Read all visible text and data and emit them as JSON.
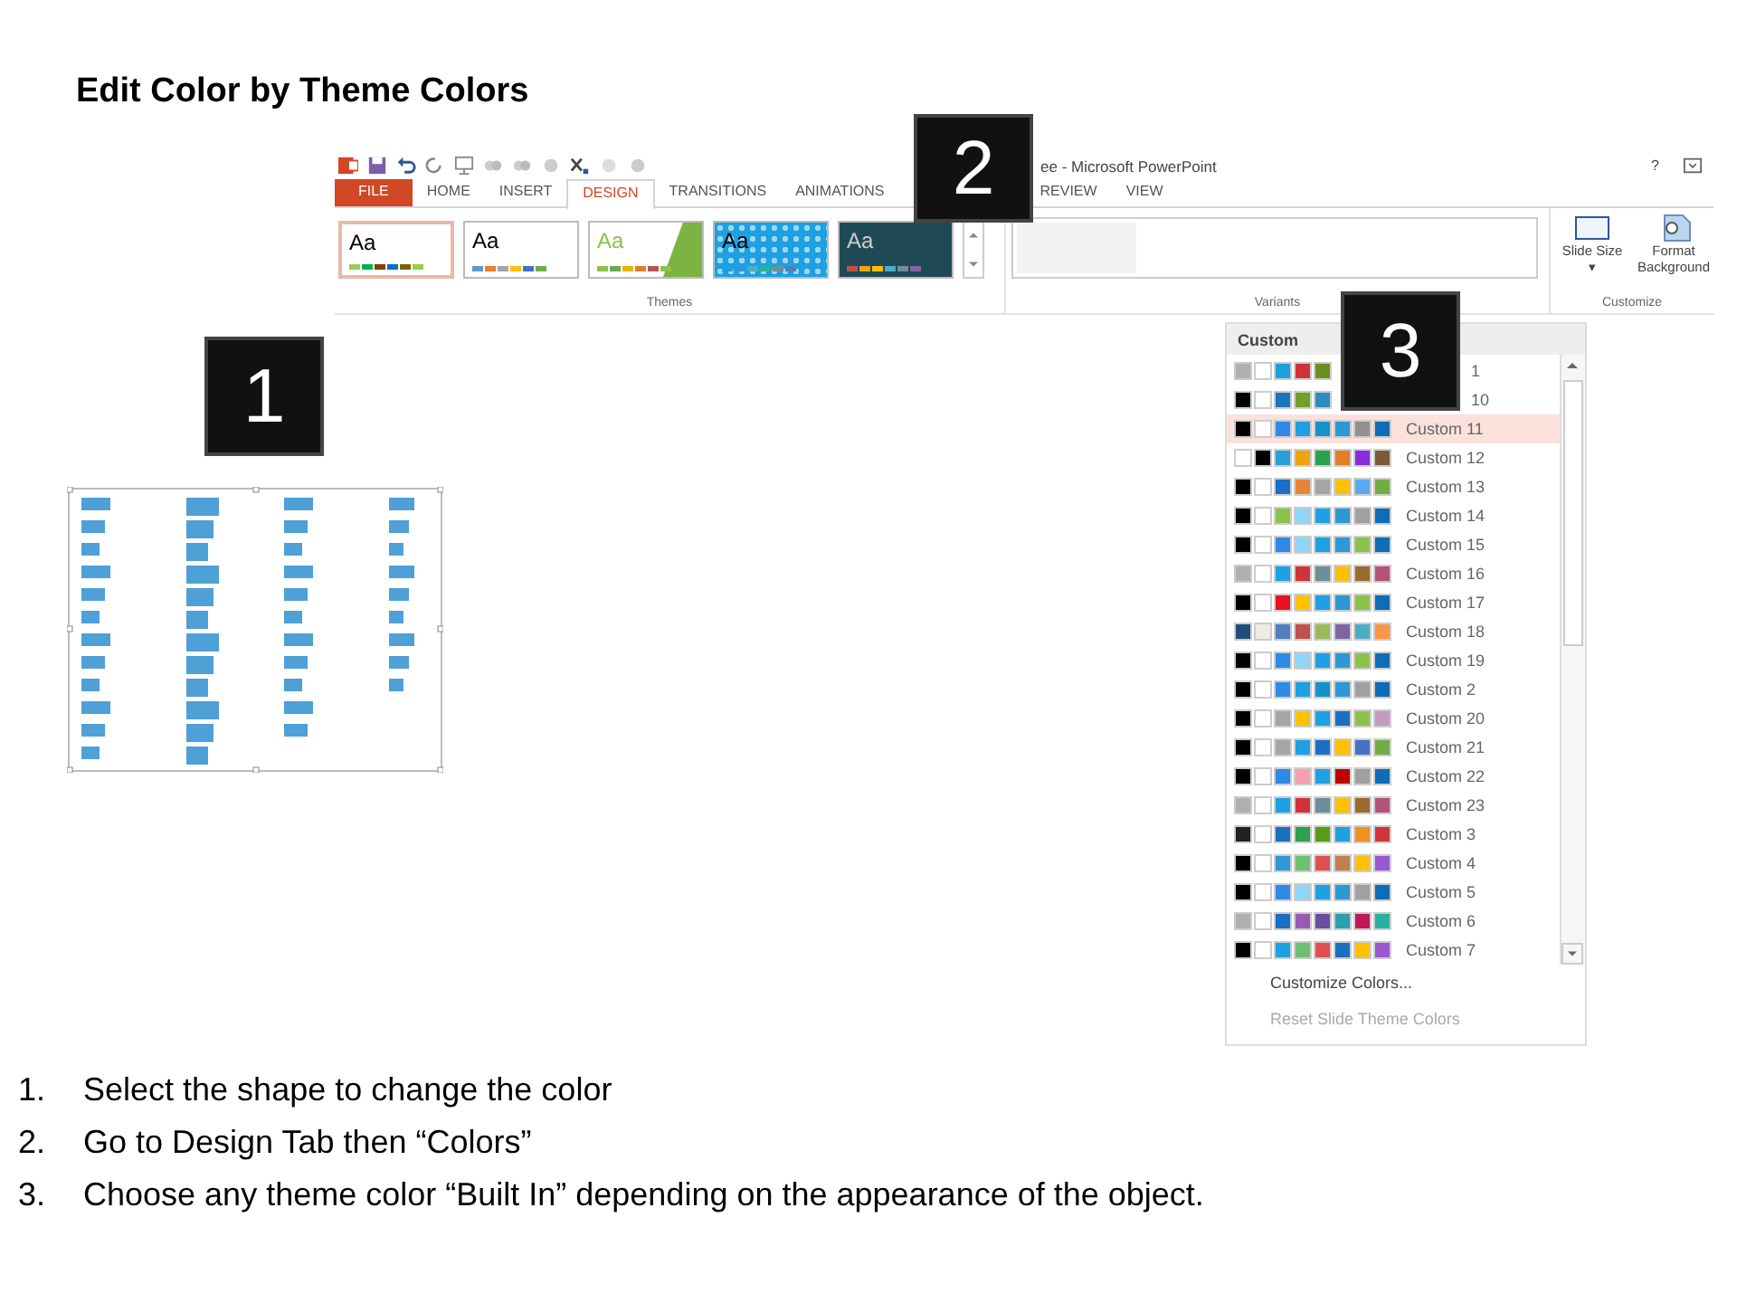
{
  "title": "Edit Color by Theme Colors",
  "ribbon": {
    "window_title": "ee - Microsoft PowerPoint",
    "help": "?",
    "tabs": [
      {
        "label": "FILE",
        "kind": "file",
        "selected": false
      },
      {
        "label": "HOME",
        "kind": "tab",
        "selected": false
      },
      {
        "label": "INSERT",
        "kind": "tab",
        "selected": false
      },
      {
        "label": "DESIGN",
        "kind": "tab",
        "selected": true
      },
      {
        "label": "TRANSITIONS",
        "kind": "tab",
        "selected": false
      },
      {
        "label": "ANIMATIONS",
        "kind": "tab",
        "selected": false
      },
      {
        "label": "REVIEW",
        "kind": "tab",
        "selected": false
      },
      {
        "label": "VIEW",
        "kind": "tab",
        "selected": false
      }
    ],
    "themes": [
      {
        "label": "Aa",
        "kind": "plain",
        "selected": true,
        "swatches": [
          {
            "color": "#92d050"
          },
          {
            "color": "#00b050"
          },
          {
            "color": "#7f3f00"
          },
          {
            "color": "#0070c0"
          },
          {
            "color": "#7f6000"
          },
          {
            "color": "#92d050"
          }
        ]
      },
      {
        "label": "Aa",
        "kind": "plain",
        "selected": false,
        "swatches": [
          {
            "color": "#5b9bd5"
          },
          {
            "color": "#ed7d31"
          },
          {
            "color": "#a5a5a5"
          },
          {
            "color": "#ffc000"
          },
          {
            "color": "#4472c4"
          },
          {
            "color": "#70ad47"
          }
        ]
      },
      {
        "label": "Aa",
        "kind": "green",
        "selected": false,
        "swatches": [
          {
            "color": "#8bc34a"
          },
          {
            "color": "#6aa84f"
          },
          {
            "color": "#e6b800"
          },
          {
            "color": "#d9822b"
          },
          {
            "color": "#b85450"
          },
          {
            "color": "#8bc34a"
          }
        ]
      },
      {
        "label": "Aa",
        "kind": "pattern",
        "selected": false,
        "swatches": [
          {
            "color": "#1da1e2"
          },
          {
            "color": "#2c98d4"
          },
          {
            "color": "#4bacc6"
          },
          {
            "color": "#2ab0a0"
          },
          {
            "color": "#6a8e9a"
          },
          {
            "color": "#4f81bd"
          }
        ]
      },
      {
        "label": "Aa",
        "kind": "dark",
        "selected": false,
        "swatches": [
          {
            "color": "#c0504d"
          },
          {
            "color": "#f0a30a"
          },
          {
            "color": "#ffc000"
          },
          {
            "color": "#4bacc6"
          },
          {
            "color": "#6a8e9a"
          },
          {
            "color": "#8064a2"
          }
        ]
      }
    ],
    "groups": [
      "Themes",
      "Variants",
      "Customize"
    ],
    "customize": [
      {
        "label": "Slide Size ▾",
        "kind": "size"
      },
      {
        "label": "Format Background",
        "kind": "background"
      }
    ]
  },
  "colors_menu": {
    "header": "Custom",
    "rows": [
      {
        "label": "1",
        "partial": true,
        "selected": false,
        "swatches": [
          {
            "color": "#b0b0b0"
          },
          {
            "color": "#ffffff"
          },
          {
            "color": "#1ba1e2"
          },
          {
            "color": "#d13438"
          },
          {
            "color": "#6b8e23"
          }
        ]
      },
      {
        "label": "10",
        "partial": true,
        "selected": false,
        "swatches": [
          {
            "color": "#000000"
          },
          {
            "color": "#ffffff"
          },
          {
            "color": "#1b75bc"
          },
          {
            "color": "#72a02a"
          },
          {
            "color": "#2a8fc0"
          }
        ]
      },
      {
        "label": "Custom 11",
        "selected": true,
        "swatches": [
          {
            "color": "#000000"
          },
          {
            "color": "#ffffff"
          },
          {
            "color": "#2e8ae6"
          },
          {
            "color": "#1da1e2"
          },
          {
            "color": "#1593c9"
          },
          {
            "color": "#2c98d4"
          },
          {
            "color": "#909090"
          },
          {
            "color": "#0f6cb6"
          }
        ]
      },
      {
        "label": "Custom 12",
        "selected": false,
        "swatches": [
          {
            "color": "#ffffff"
          },
          {
            "color": "#000000"
          },
          {
            "color": "#2a9fd6"
          },
          {
            "color": "#f0a30a"
          },
          {
            "color": "#2ca04d"
          },
          {
            "color": "#e67e22"
          },
          {
            "color": "#8a2be2"
          },
          {
            "color": "#7b5a34"
          }
        ]
      },
      {
        "label": "Custom 13",
        "selected": false,
        "swatches": [
          {
            "color": "#000000"
          },
          {
            "color": "#ffffff"
          },
          {
            "color": "#1b6fc2"
          },
          {
            "color": "#e8833a"
          },
          {
            "color": "#a5a5a5"
          },
          {
            "color": "#ffc000"
          },
          {
            "color": "#5aaaf0"
          },
          {
            "color": "#70ad47"
          }
        ]
      },
      {
        "label": "Custom 14",
        "selected": false,
        "swatches": [
          {
            "color": "#000000"
          },
          {
            "color": "#ffffff"
          },
          {
            "color": "#8bc34a"
          },
          {
            "color": "#90d5f5"
          },
          {
            "color": "#1da1e2"
          },
          {
            "color": "#2c98d4"
          },
          {
            "color": "#a0a0a0"
          },
          {
            "color": "#0f6cb6"
          }
        ]
      },
      {
        "label": "Custom 15",
        "selected": false,
        "swatches": [
          {
            "color": "#000000"
          },
          {
            "color": "#ffffff"
          },
          {
            "color": "#2e8ae6"
          },
          {
            "color": "#90d5f5"
          },
          {
            "color": "#1da1e2"
          },
          {
            "color": "#2c98d4"
          },
          {
            "color": "#8bc34a"
          },
          {
            "color": "#0f6cb6"
          }
        ]
      },
      {
        "label": "Custom 16",
        "selected": false,
        "swatches": [
          {
            "color": "#b0b0b0"
          },
          {
            "color": "#ffffff"
          },
          {
            "color": "#1da1e2"
          },
          {
            "color": "#d13438"
          },
          {
            "color": "#6a8e9a"
          },
          {
            "color": "#ffc000"
          },
          {
            "color": "#9b6a2f"
          },
          {
            "color": "#b5527a"
          }
        ]
      },
      {
        "label": "Custom 17",
        "selected": false,
        "swatches": [
          {
            "color": "#000000"
          },
          {
            "color": "#ffffff"
          },
          {
            "color": "#e81123"
          },
          {
            "color": "#ffc000"
          },
          {
            "color": "#1da1e2"
          },
          {
            "color": "#2c98d4"
          },
          {
            "color": "#8bc34a"
          },
          {
            "color": "#0f6cb6"
          }
        ]
      },
      {
        "label": "Custom 18",
        "selected": false,
        "swatches": [
          {
            "color": "#1f4e79"
          },
          {
            "color": "#eeece1"
          },
          {
            "color": "#4f81bd"
          },
          {
            "color": "#c0504d"
          },
          {
            "color": "#9bbb59"
          },
          {
            "color": "#8064a2"
          },
          {
            "color": "#4bacc6"
          },
          {
            "color": "#f79646"
          }
        ]
      },
      {
        "label": "Custom 19",
        "selected": false,
        "swatches": [
          {
            "color": "#000000"
          },
          {
            "color": "#ffffff"
          },
          {
            "color": "#2e8ae6"
          },
          {
            "color": "#90d5f5"
          },
          {
            "color": "#1da1e2"
          },
          {
            "color": "#2c98d4"
          },
          {
            "color": "#8bc34a"
          },
          {
            "color": "#0f6cb6"
          }
        ]
      },
      {
        "label": "Custom 2",
        "selected": false,
        "swatches": [
          {
            "color": "#000000"
          },
          {
            "color": "#ffffff"
          },
          {
            "color": "#2e8ae6"
          },
          {
            "color": "#1da1e2"
          },
          {
            "color": "#1593c9"
          },
          {
            "color": "#2c98d4"
          },
          {
            "color": "#a0a0a0"
          },
          {
            "color": "#0f6cb6"
          }
        ]
      },
      {
        "label": "Custom 20",
        "selected": false,
        "swatches": [
          {
            "color": "#000000"
          },
          {
            "color": "#ffffff"
          },
          {
            "color": "#a5a5a5"
          },
          {
            "color": "#ffc000"
          },
          {
            "color": "#1da1e2"
          },
          {
            "color": "#1b6fc2"
          },
          {
            "color": "#8bc34a"
          },
          {
            "color": "#c49ac0"
          }
        ]
      },
      {
        "label": "Custom 21",
        "selected": false,
        "swatches": [
          {
            "color": "#000000"
          },
          {
            "color": "#ffffff"
          },
          {
            "color": "#a5a5a5"
          },
          {
            "color": "#1da1e2"
          },
          {
            "color": "#1b6fc2"
          },
          {
            "color": "#ffc000"
          },
          {
            "color": "#4472c4"
          },
          {
            "color": "#70ad47"
          }
        ]
      },
      {
        "label": "Custom 22",
        "selected": false,
        "swatches": [
          {
            "color": "#000000"
          },
          {
            "color": "#ffffff"
          },
          {
            "color": "#2e8ae6"
          },
          {
            "color": "#f4a0b0"
          },
          {
            "color": "#1da1e2"
          },
          {
            "color": "#c00000"
          },
          {
            "color": "#a0a0a0"
          },
          {
            "color": "#0f6cb6"
          }
        ]
      },
      {
        "label": "Custom 23",
        "selected": false,
        "swatches": [
          {
            "color": "#b0b0b0"
          },
          {
            "color": "#ffffff"
          },
          {
            "color": "#1da1e2"
          },
          {
            "color": "#d13438"
          },
          {
            "color": "#6a8e9a"
          },
          {
            "color": "#ffc000"
          },
          {
            "color": "#9b6a2f"
          },
          {
            "color": "#b5527a"
          }
        ]
      },
      {
        "label": "Custom 3",
        "selected": false,
        "swatches": [
          {
            "color": "#222222"
          },
          {
            "color": "#ffffff"
          },
          {
            "color": "#1b6fc2"
          },
          {
            "color": "#2ca04d"
          },
          {
            "color": "#5a9a1a"
          },
          {
            "color": "#1da1e2"
          },
          {
            "color": "#f0901e"
          },
          {
            "color": "#d13438"
          }
        ]
      },
      {
        "label": "Custom 4",
        "selected": false,
        "swatches": [
          {
            "color": "#000000"
          },
          {
            "color": "#ffffff"
          },
          {
            "color": "#2c98d4"
          },
          {
            "color": "#6cc070"
          },
          {
            "color": "#e05050"
          },
          {
            "color": "#c08050"
          },
          {
            "color": "#ffc000"
          },
          {
            "color": "#9b59d0"
          }
        ]
      },
      {
        "label": "Custom 5",
        "selected": false,
        "swatches": [
          {
            "color": "#000000"
          },
          {
            "color": "#ffffff"
          },
          {
            "color": "#2e8ae6"
          },
          {
            "color": "#90d5f5"
          },
          {
            "color": "#1da1e2"
          },
          {
            "color": "#2c98d4"
          },
          {
            "color": "#a0a0a0"
          },
          {
            "color": "#0f6cb6"
          }
        ]
      },
      {
        "label": "Custom 6",
        "selected": false,
        "swatches": [
          {
            "color": "#b0b0b0"
          },
          {
            "color": "#ffffff"
          },
          {
            "color": "#1b6fc2"
          },
          {
            "color": "#9b59b6"
          },
          {
            "color": "#6a4fa0"
          },
          {
            "color": "#2aa0b0"
          },
          {
            "color": "#c0185a"
          },
          {
            "color": "#2ab0a0"
          }
        ]
      },
      {
        "label": "Custom 7",
        "selected": false,
        "swatches": [
          {
            "color": "#000000"
          },
          {
            "color": "#ffffff"
          },
          {
            "color": "#1da1e2"
          },
          {
            "color": "#6cc070"
          },
          {
            "color": "#e05050"
          },
          {
            "color": "#1b6fc2"
          },
          {
            "color": "#ffc000"
          },
          {
            "color": "#9b59d0"
          }
        ]
      }
    ],
    "actions": [
      {
        "label": "Customize Colors...",
        "disabled": false
      },
      {
        "label": "Reset Slide Theme Colors",
        "disabled": true
      }
    ]
  },
  "badges": [
    "1",
    "2",
    "3"
  ],
  "steps": [
    {
      "number": "1.",
      "text": "Select the shape to change the color"
    },
    {
      "number": "2.",
      "text": "Go to Design Tab then “Colors”"
    },
    {
      "number": "3.",
      "text": "Choose any theme color “Built In” depending on the appearance of the object."
    }
  ]
}
